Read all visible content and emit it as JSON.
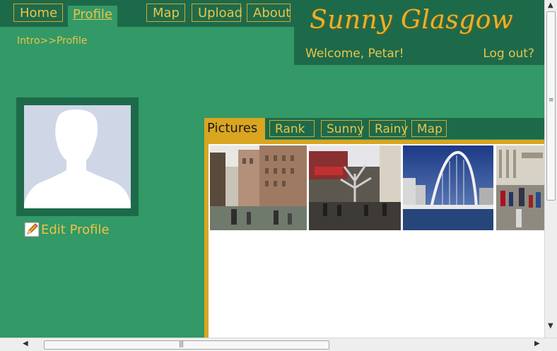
{
  "nav": {
    "home": "Home",
    "profile": "Profile",
    "map": "Map",
    "upload": "Upload",
    "about": "About"
  },
  "breadcrumb": "Intro>>Profile",
  "header": {
    "brand": "Sunny Glasgow",
    "welcome": "Welcome, Petar!",
    "logout": "Log out?"
  },
  "profile": {
    "edit_label": "Edit Profile"
  },
  "tabs": {
    "pictures": "Pictures",
    "rank": "Rank",
    "sunny": "Sunny",
    "rainy": "Rainy",
    "map": "Map"
  },
  "colors": {
    "page_bg": "#339966",
    "dark_green": "#1d6a4a",
    "gold": "#daa520",
    "text_gold": "#e8c44a"
  },
  "icons": {
    "pencil": "pencil-icon",
    "avatar": "avatar-silhouette-icon"
  }
}
